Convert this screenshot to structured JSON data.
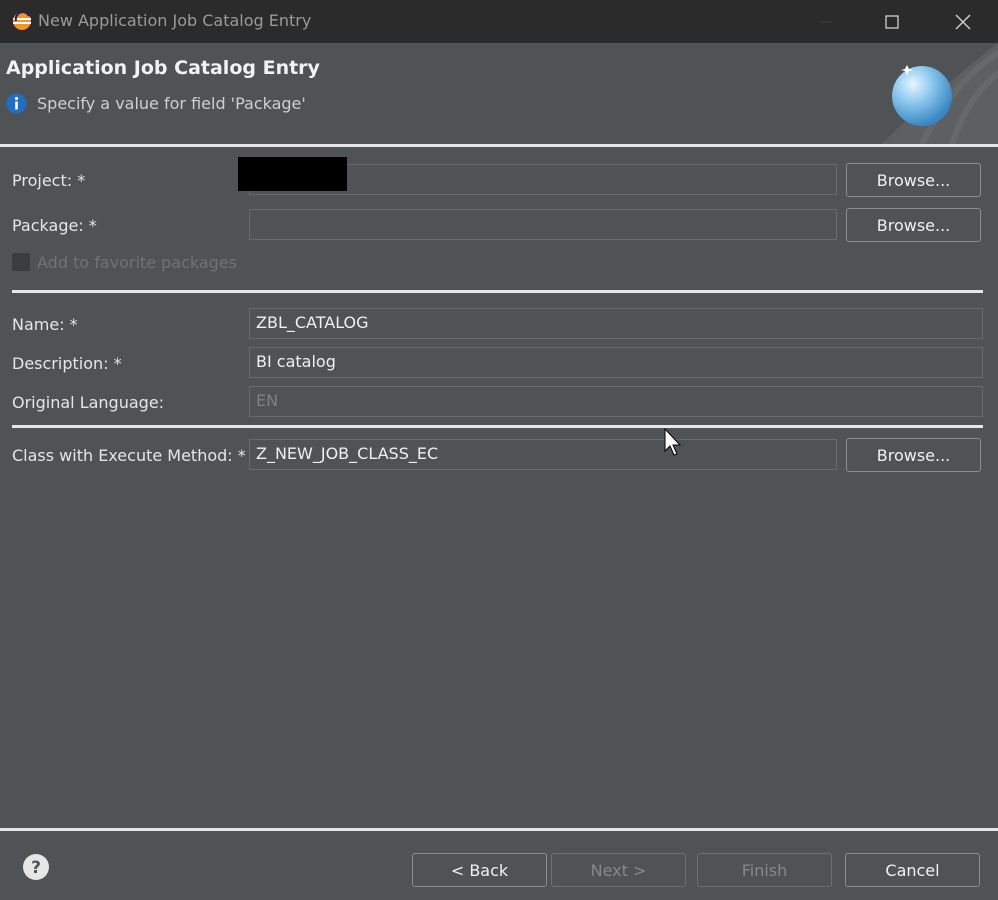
{
  "window": {
    "title": "New Application Job Catalog Entry"
  },
  "banner": {
    "title": "Application Job Catalog Entry",
    "message": "Specify a value for field 'Package'"
  },
  "form": {
    "project_label": "Project: *",
    "project_value": "",
    "package_label": "Package: *",
    "package_value": "",
    "favorite_label": "Add to favorite packages",
    "name_label": "Name: *",
    "name_value": "ZBL_CATALOG",
    "description_label": "Description: *",
    "description_value": "BI catalog",
    "language_label": "Original Language:",
    "language_value": "EN",
    "class_label": "Class with Execute Method: *",
    "class_value": "Z_NEW_JOB_CLASS_EC",
    "browse_label": "Browse..."
  },
  "footer": {
    "back_label": "< Back",
    "next_label": "Next >",
    "finish_label": "Finish",
    "cancel_label": "Cancel"
  },
  "icons": {
    "app": "eclipse-icon",
    "info": "info-icon",
    "help": "help-icon",
    "wizard": "wizard-banner-icon"
  }
}
